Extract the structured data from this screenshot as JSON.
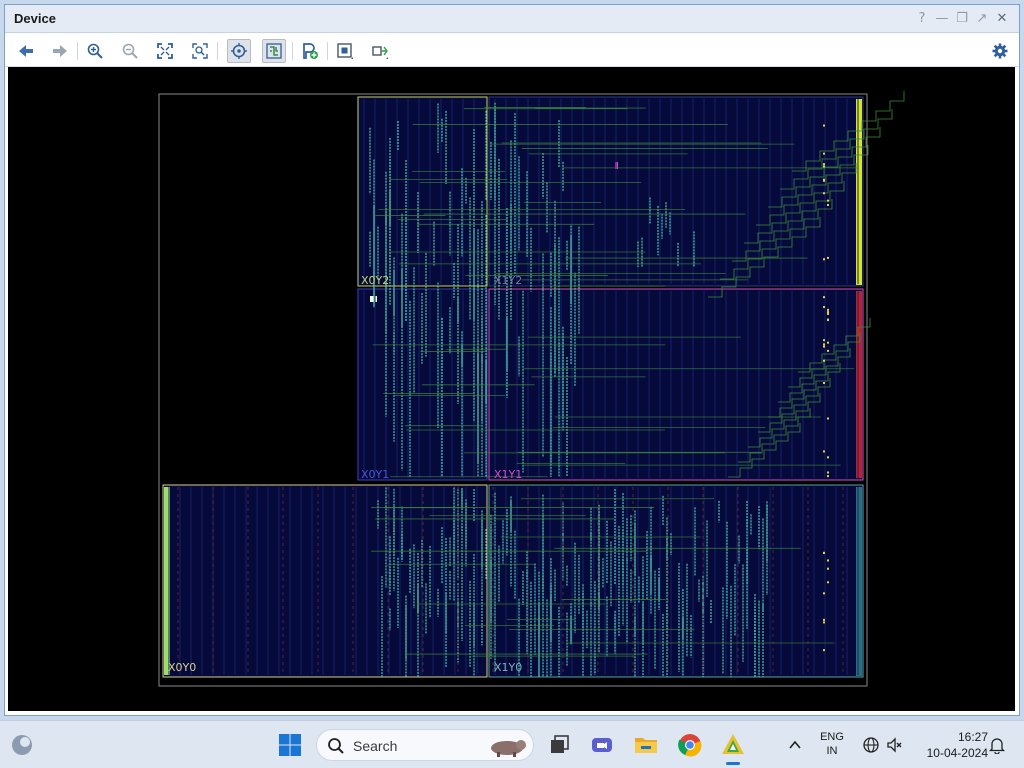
{
  "window": {
    "title": "Device",
    "controls": [
      "help-icon",
      "minimize-icon",
      "restore-icon",
      "float-icon",
      "close-icon"
    ]
  },
  "toolbar": {
    "buttons": [
      "back-icon",
      "forward-icon",
      "zoom-in-icon",
      "zoom-out-icon",
      "zoom-fit-icon",
      "zoom-selection-icon",
      "autofit-selection-icon",
      "routing-resources-icon",
      "add-pblock-icon",
      "add-cell-icon",
      "expand-icon",
      "settings-icon"
    ],
    "active": [
      "autofit-selection-icon",
      "routing-resources-icon"
    ]
  },
  "device": {
    "clock_regions": [
      "X0Y2",
      "X1Y2",
      "X0Y1",
      "X1Y1",
      "X0Y0",
      "X1Y0"
    ],
    "colors": {
      "background": "#000000",
      "region_fill": "#060a3a",
      "routing": "#4ec9b0",
      "x0y2_border": "#c8d46a",
      "x1y1_border": "#d04fc8",
      "x0y1_border": "#3b3fbf",
      "x0y0_border": "#d6d08a",
      "x1y0_border": "#5aa0a8",
      "io_top": "#d6e62a",
      "io_mid": "#b8242a",
      "io_bottom": "#2a6f7c",
      "io_left_bottom": "#9fdc6a"
    }
  },
  "taskbar": {
    "search_placeholder": "Search",
    "language": "ENG",
    "region": "IN",
    "time": "16:27",
    "date": "10-04-2024",
    "icons": [
      "copilot-icon",
      "windows-start-icon",
      "search-icon",
      "task-view-icon",
      "meet-icon",
      "file-explorer-icon",
      "chrome-icon",
      "vivado-icon",
      "chevron-up-icon",
      "network-icon",
      "sound-muted-icon",
      "notification-bell-icon"
    ]
  }
}
